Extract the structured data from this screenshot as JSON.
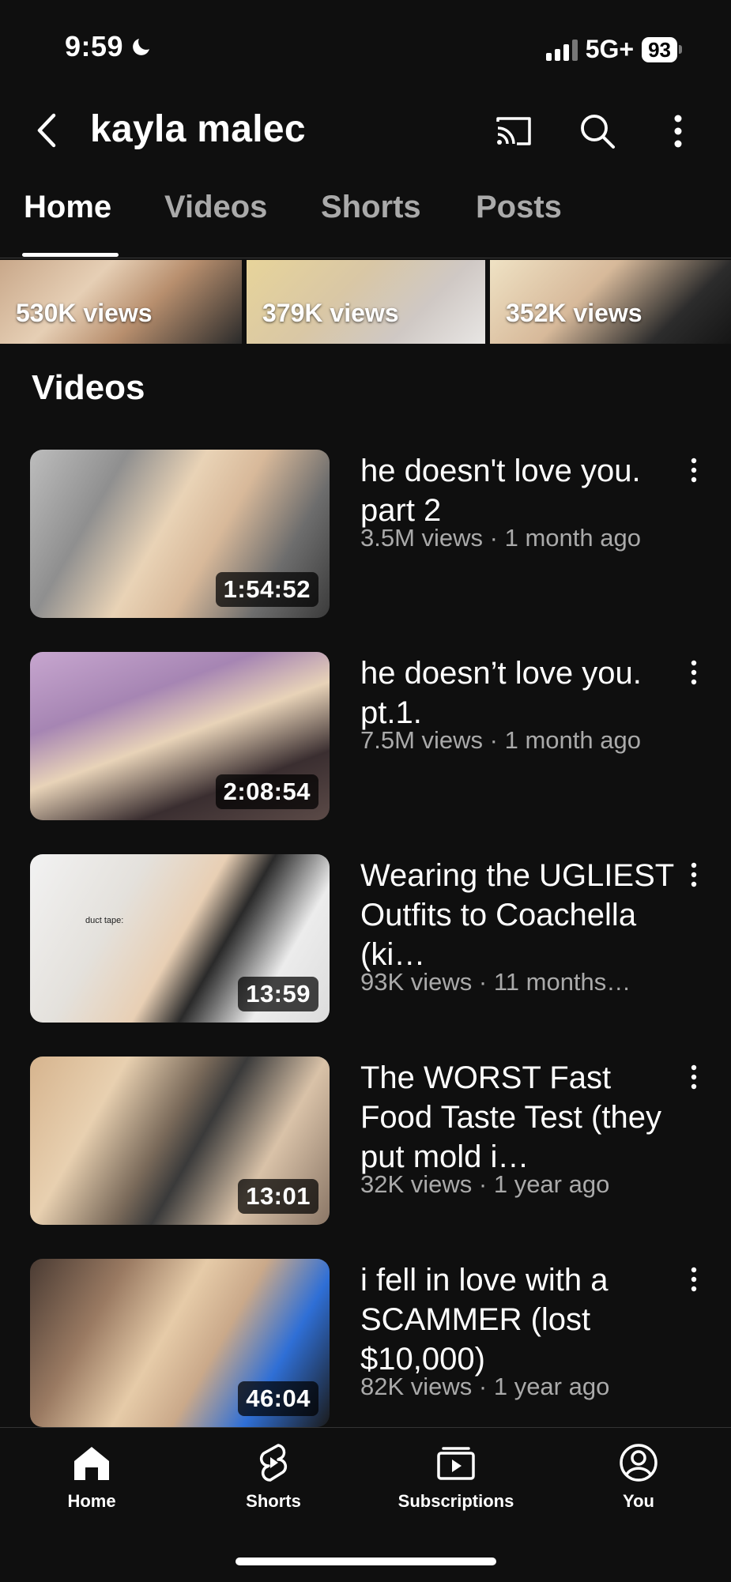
{
  "status_bar": {
    "time": "9:59",
    "network": "5G+",
    "battery": "93"
  },
  "header": {
    "channel_name": "kayla malec",
    "icons": [
      "back-icon",
      "cast-icon",
      "search-icon",
      "more-icon"
    ]
  },
  "tabs": [
    {
      "label": "Home",
      "active": true
    },
    {
      "label": "Videos",
      "active": false
    },
    {
      "label": "Shorts",
      "active": false
    },
    {
      "label": "Posts",
      "active": false
    }
  ],
  "shorts": [
    {
      "views": "530K views"
    },
    {
      "views": "379K views"
    },
    {
      "views": "352K views"
    }
  ],
  "section_title": "Videos",
  "videos": [
    {
      "title": "he doesn't love you. part 2",
      "meta": "3.5M views · 1 month ago",
      "duration": "1:54:52"
    },
    {
      "title": "he doesn’t love you. pt.1.",
      "meta": "7.5M views · 1 month ago",
      "duration": "2:08:54"
    },
    {
      "title": "Wearing the UGLIEST Outfits to Coachella (ki…",
      "meta": "93K views · 11 months…",
      "duration": "13:59",
      "thumb_text": "duct tape:"
    },
    {
      "title": "The WORST Fast Food Taste Test (they put mold i…",
      "meta": "32K views · 1 year ago",
      "duration": "13:01"
    },
    {
      "title": "i fell in love with a SCAMMER (lost $10,000)",
      "meta": "82K views · 1 year ago",
      "duration": "46:04"
    }
  ],
  "bottom_nav": [
    {
      "label": "Home",
      "icon": "home-icon"
    },
    {
      "label": "Shorts",
      "icon": "shorts-icon"
    },
    {
      "label": "Subscriptions",
      "icon": "subscriptions-icon"
    },
    {
      "label": "You",
      "icon": "account-icon"
    }
  ],
  "colors": {
    "background": "#0f0f0f",
    "text": "#ffffff",
    "secondary_text": "#aaaaaa"
  }
}
